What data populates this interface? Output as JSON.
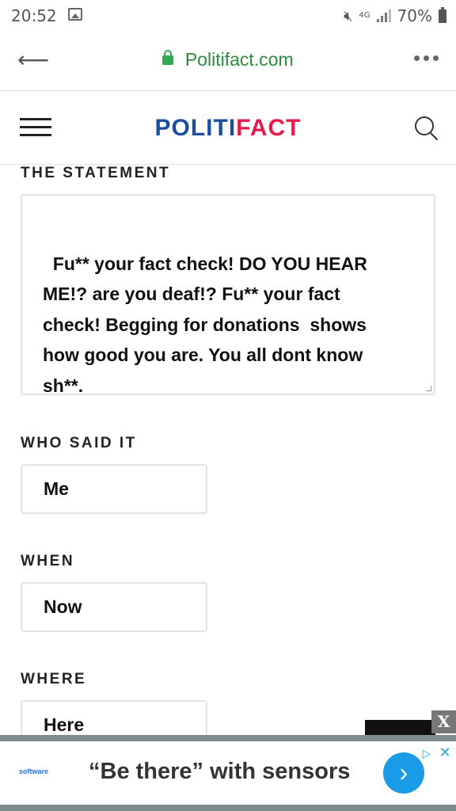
{
  "status_bar": {
    "time": "20:52",
    "network": "4G",
    "battery": "70%"
  },
  "browser": {
    "url": "Politifact.com"
  },
  "site": {
    "logo_part1": "POLITI",
    "logo_part2": "FACT",
    "brand_colors": {
      "blue": "#1d4e9e",
      "red": "#e51b4d"
    }
  },
  "form": {
    "statement_label": "THE STATEMENT",
    "statement_value": "Fu** your fact check! DO YOU HEAR\nME!? are you deaf!? Fu** your fact\ncheck! Begging for donations  shows\nhow good you are. You all dont know\nsh**.",
    "who_label": "WHO SAID IT",
    "who_value": "Me",
    "when_label": "WHEN",
    "when_value": "Now",
    "where_label": "WHERE",
    "where_value": "Here"
  },
  "ad": {
    "close": "X",
    "brand": "software",
    "text": "“Be there” with sensors",
    "cta": "›"
  }
}
